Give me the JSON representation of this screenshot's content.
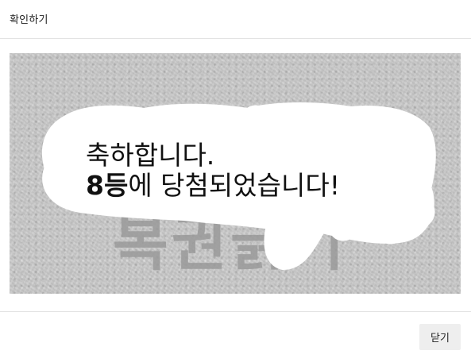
{
  "dialog": {
    "title": "확인하기"
  },
  "scratch_card": {
    "watermark_text": "복권긁기",
    "result_line1": "축하합니다.",
    "result_rank": "8등",
    "result_line2_rest": "에 당첨되었습니다!"
  },
  "footer": {
    "close_label": "닫기"
  }
}
